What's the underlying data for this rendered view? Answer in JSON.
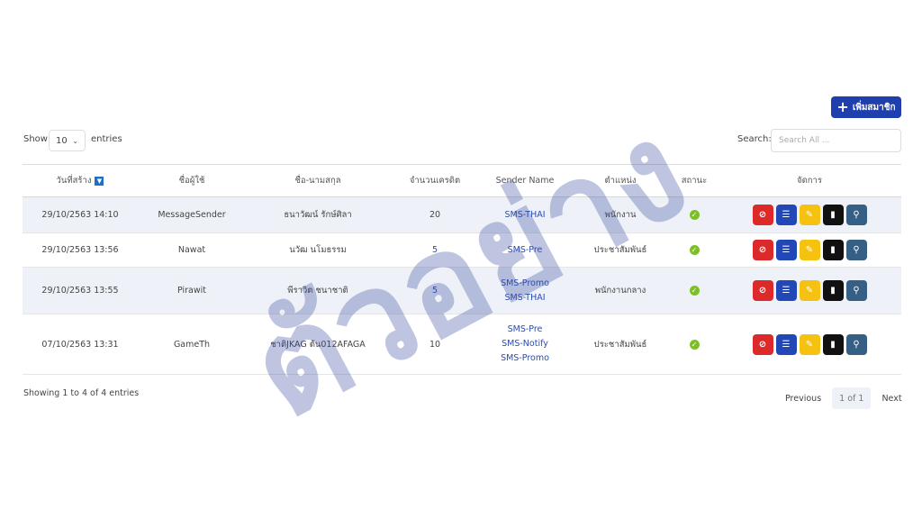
{
  "toolbar": {
    "add_label": "เพิ่มสมาชิก",
    "add_icon": "plus-icon"
  },
  "length": {
    "show_label": "Show",
    "value": "10",
    "entries_label": "entries"
  },
  "search": {
    "label": "Search:",
    "placeholder": "Search All ..."
  },
  "table": {
    "columns": [
      "วันที่สร้าง",
      "ชื่อผู้ใช้",
      "ชื่อ-นามสกุล",
      "จำนวนเครดิต",
      "Sender Name",
      "ตำแหน่ง",
      "สถานะ",
      "จัดการ"
    ],
    "rows": [
      {
        "date": "29/10/2563 14:10",
        "user": "MessageSender",
        "name": "ธนาวัฒน์ รักษ์ศิลา",
        "credit": "20",
        "senders": [
          "SMS-THAI"
        ],
        "position": "พนักงาน",
        "status": "active"
      },
      {
        "date": "29/10/2563 13:56",
        "user": "Nawat",
        "name": "นวัฒ นโมธรรม",
        "credit": "5",
        "senders": [
          "SMS-Pre"
        ],
        "position": "ประชาสัมพันธ์",
        "status": "active"
      },
      {
        "date": "29/10/2563 13:55",
        "user": "Pirawit",
        "name": "พีราวิต ชนาชาติ",
        "credit": "5",
        "senders": [
          "SMS-Promo",
          "SMS-THAI"
        ],
        "position": "พนักงานกลาง",
        "status": "active"
      },
      {
        "date": "07/10/2563 13:31",
        "user": "GameTh",
        "name": "ชาติJKAG ต้น012AFAGA",
        "credit": "10",
        "senders": [
          "SMS-Pre",
          "SMS-Notify",
          "SMS-Promo"
        ],
        "position": "ประชาสัมพันธ์",
        "status": "active"
      }
    ],
    "action_icons": [
      "ban-icon",
      "coins-icon",
      "edit-icon",
      "trash-icon",
      "key-icon"
    ]
  },
  "info": "Showing 1 to 4 of 4 entries",
  "pagination": {
    "previous": "Previous",
    "current": "1 of 1",
    "next": "Next"
  },
  "watermark": "ตัวอย่าง",
  "colors": {
    "primary": "#1f3fae",
    "danger": "#dc2a2a",
    "warning": "#f5c211",
    "dark": "#111111",
    "slate": "#365f86",
    "success": "#7cbf27",
    "row_alt": "#eef2f8"
  }
}
